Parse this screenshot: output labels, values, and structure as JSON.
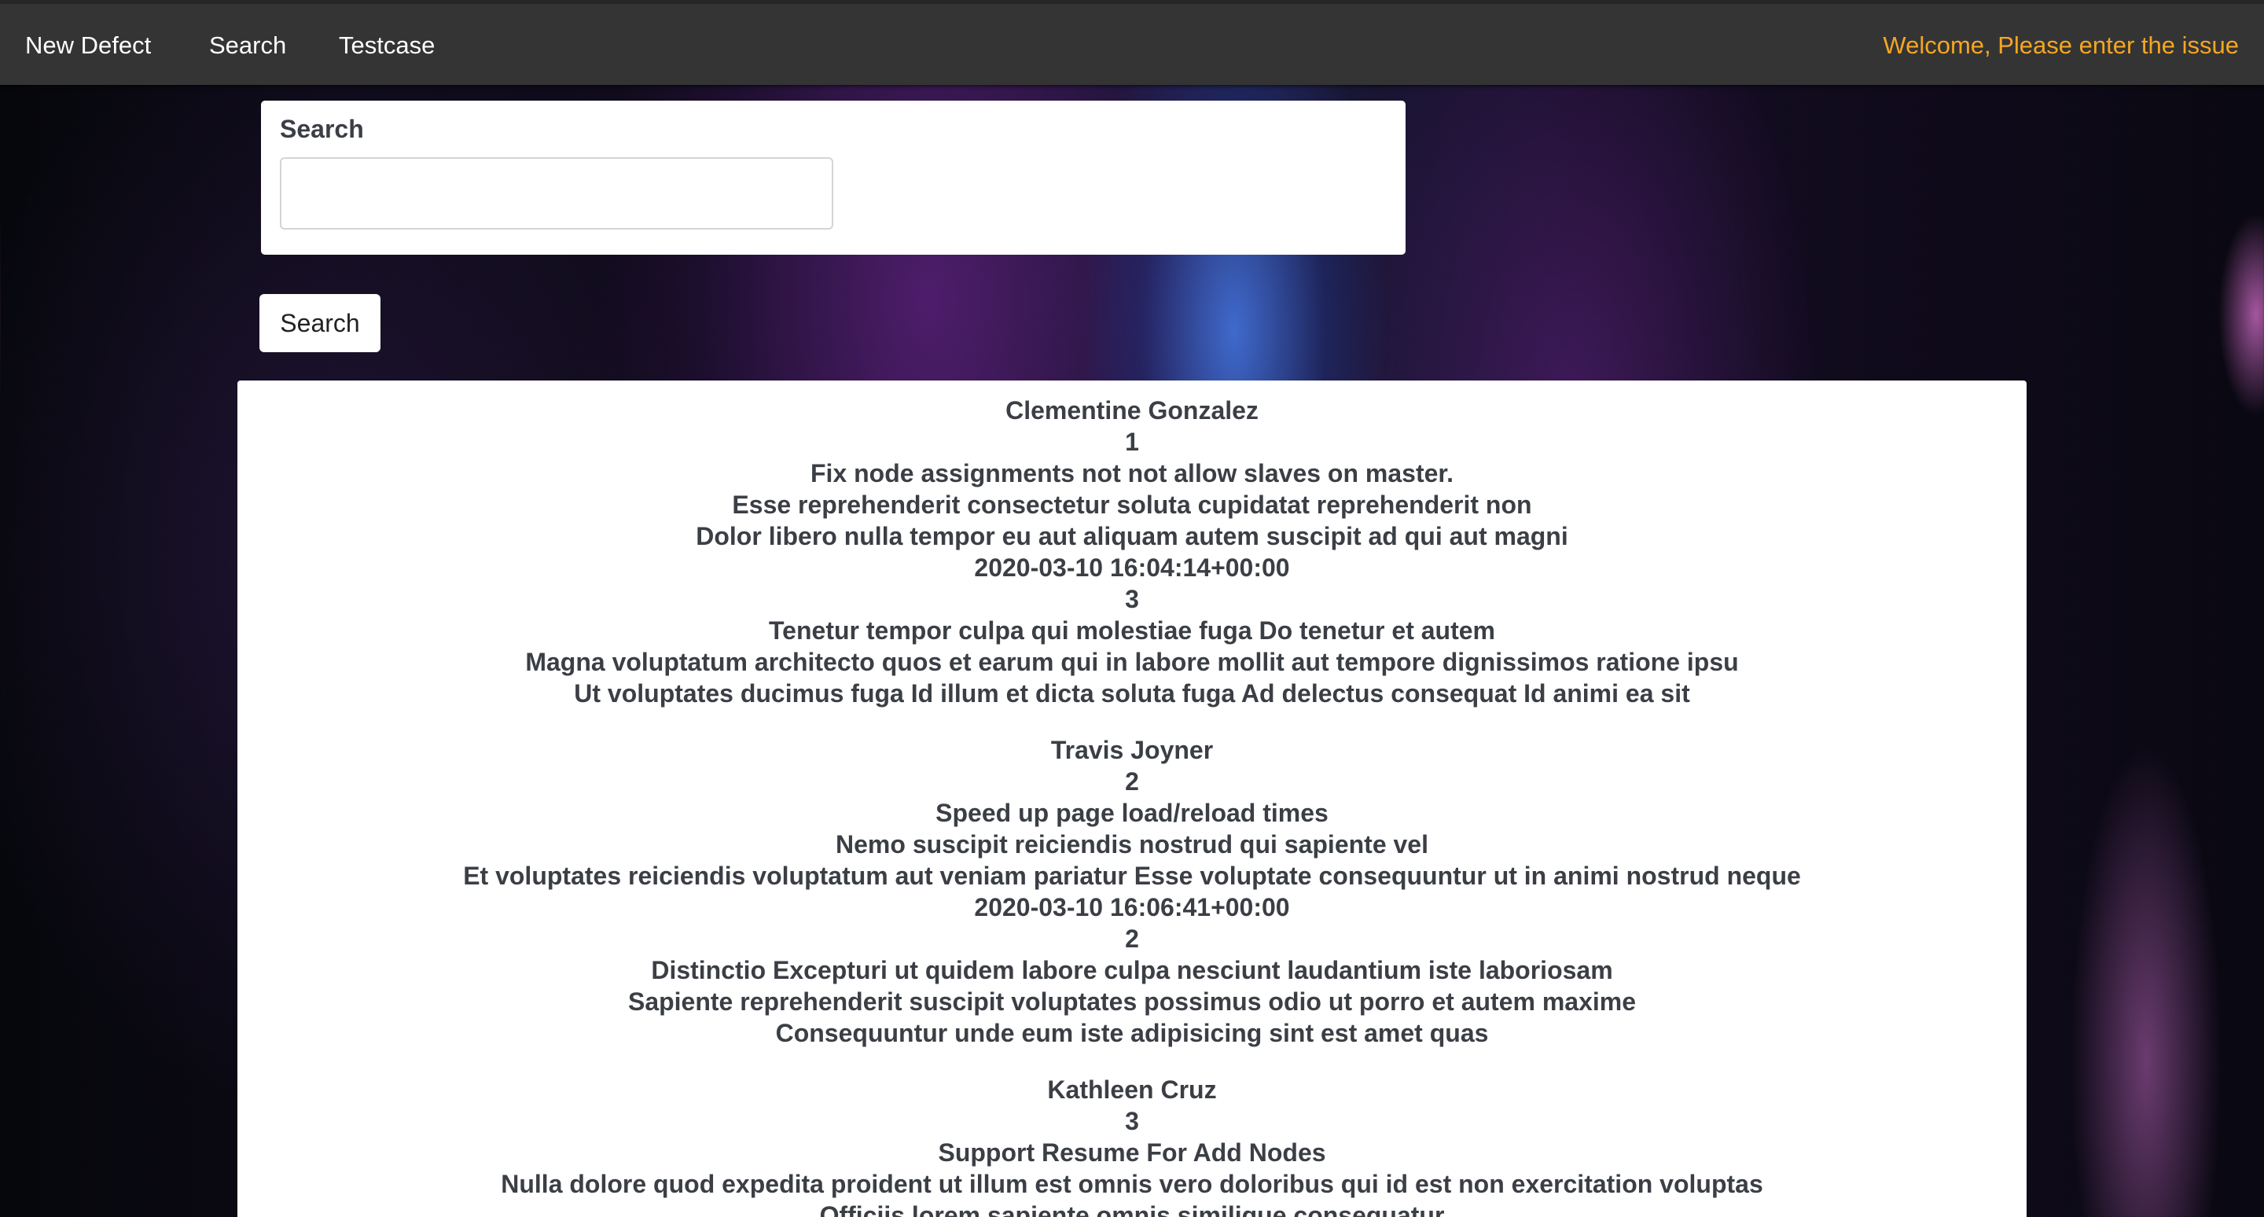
{
  "navbar": {
    "links": [
      "New Defect",
      "Search",
      "Testcase"
    ],
    "welcome": "Welcome, Please enter the issue"
  },
  "search": {
    "label": "Search",
    "value": "",
    "button_label": "Search"
  },
  "results": [
    {
      "name": "Clementine Gonzalez",
      "id": "1",
      "title": "Fix node assignments not not allow slaves on master.",
      "summary": "Esse reprehenderit consectetur soluta cupidatat reprehenderit non",
      "description": "Dolor libero nulla tempor eu aut aliquam autem suscipit ad qui aut magni",
      "timestamp": "2020-03-10 16:04:14+00:00",
      "priority": "3",
      "steps": "Tenetur tempor culpa qui molestiae fuga Do tenetur et autem",
      "expected": "Magna voluptatum architecto quos et earum qui in labore mollit aut tempore dignissimos ratione ipsu",
      "actual": "Ut voluptates ducimus fuga Id illum et dicta soluta fuga Ad delectus consequat Id animi ea sit"
    },
    {
      "name": "Travis Joyner",
      "id": "2",
      "title": "Speed up page load/reload times",
      "summary": "Nemo suscipit reiciendis nostrud qui sapiente vel",
      "description": "Et voluptates reiciendis voluptatum aut veniam pariatur Esse voluptate consequuntur ut in animi nostrud neque",
      "timestamp": "2020-03-10 16:06:41+00:00",
      "priority": "2",
      "steps": "Distinctio Excepturi ut quidem labore culpa nesciunt laudantium iste laboriosam",
      "expected": "Sapiente reprehenderit suscipit voluptates possimus odio ut porro et autem maxime",
      "actual": "Consequuntur unde eum iste adipisicing sint est amet quas"
    },
    {
      "name": "Kathleen Cruz",
      "id": "3",
      "title": "Support Resume For Add Nodes",
      "summary": "Nulla dolore quod expedita proident ut illum est omnis vero doloribus qui id est non exercitation voluptas",
      "description": "Officiis lorem sapiente omnis similique consequatur",
      "timestamp": "",
      "priority": "",
      "steps": "",
      "expected": "",
      "actual": ""
    }
  ]
}
